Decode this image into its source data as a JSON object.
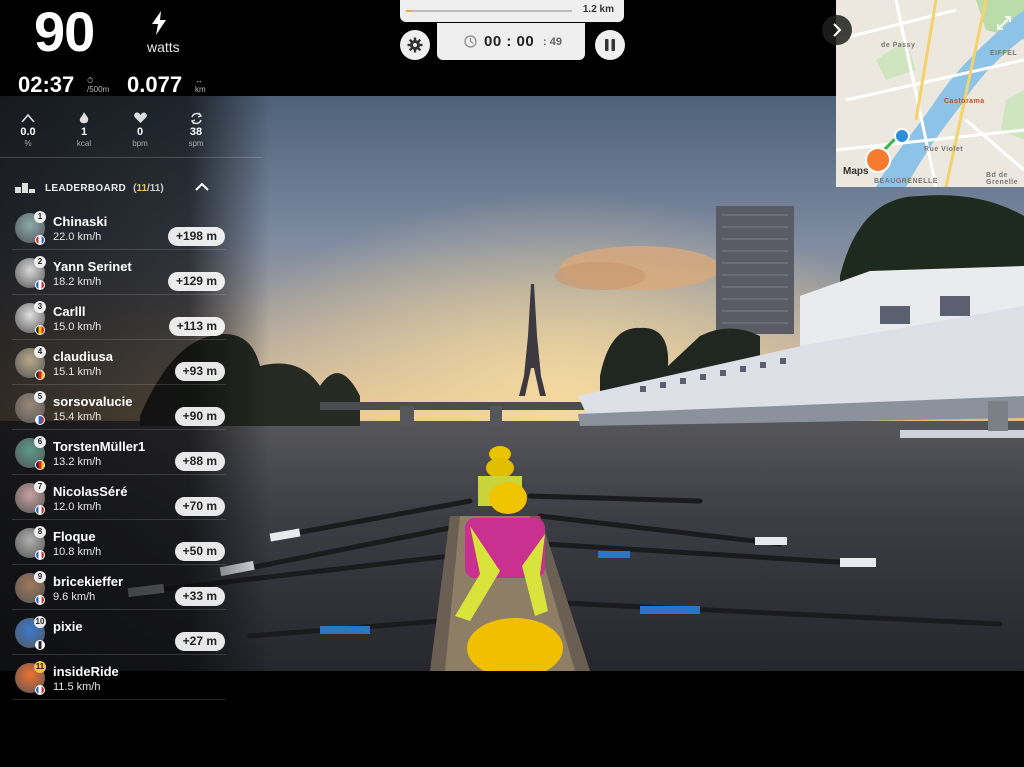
{
  "stats": {
    "power_value": "90",
    "power_unit": "watts",
    "split_time": "02:37",
    "split_unit": "/500m",
    "distance_value": "0.077",
    "distance_unit": "km",
    "incline_value": "0.0",
    "incline_unit": "%",
    "calories_value": "1",
    "calories_unit": "kcal",
    "heart_value": "0",
    "heart_unit": "bpm",
    "cadence_value": "38",
    "cadence_unit": "spm"
  },
  "route": {
    "progress_fraction": 0.03,
    "total_distance": "1.2 km"
  },
  "timer": {
    "hours": "00",
    "minutes": "00",
    "seconds": "49"
  },
  "map": {
    "brand": "Maps",
    "labels": [
      "BEAUGRENELLE",
      "de Passy",
      "EIFFEL",
      "Castorama",
      "Bd de Grenelle",
      "Rue Violet"
    ]
  },
  "leaderboard": {
    "title": "LEADERBOARD",
    "count_current": "11",
    "count_total": "/11",
    "entries": [
      {
        "rank": "1",
        "name": "Chinaski",
        "speed": "22.0 km/h",
        "gap": "+198 m"
      },
      {
        "rank": "2",
        "name": "Yann Serinet",
        "speed": "18.2 km/h",
        "gap": "+129 m"
      },
      {
        "rank": "3",
        "name": "Carlll",
        "speed": "15.0 km/h",
        "gap": "+113 m"
      },
      {
        "rank": "4",
        "name": "claudiusa",
        "speed": "15.1 km/h",
        "gap": "+93 m"
      },
      {
        "rank": "5",
        "name": "sorsovalucie",
        "speed": "15.4 km/h",
        "gap": "+90 m"
      },
      {
        "rank": "6",
        "name": "TorstenMüller1",
        "speed": "13.2 km/h",
        "gap": "+88 m"
      },
      {
        "rank": "7",
        "name": "NicolasSéré",
        "speed": "12.0 km/h",
        "gap": "+70 m"
      },
      {
        "rank": "8",
        "name": "Floque",
        "speed": "10.8 km/h",
        "gap": "+50 m"
      },
      {
        "rank": "9",
        "name": "bricekieffer",
        "speed": "9.6 km/h",
        "gap": "+33 m"
      },
      {
        "rank": "10",
        "name": "pixie",
        "speed": "",
        "gap": "+27 m"
      },
      {
        "rank": "11",
        "name": "insideRide",
        "speed": "11.5 km/h",
        "gap": ""
      }
    ]
  },
  "colors": {
    "accent": "#f2a33a",
    "count_highlight": "#f2c14e",
    "panel": "#efefef"
  }
}
